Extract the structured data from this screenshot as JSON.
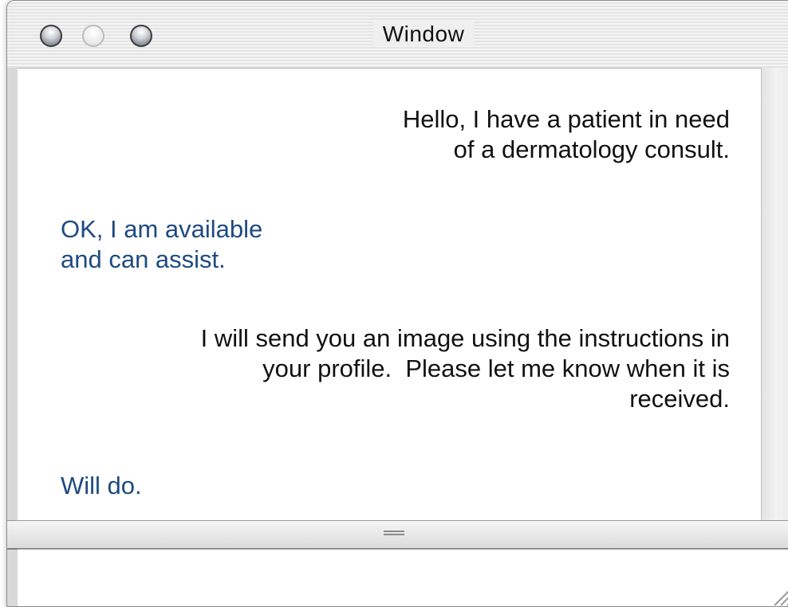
{
  "window": {
    "title": "Window"
  },
  "messages": [
    {
      "direction": "out",
      "lines": [
        "Hello, I have a patient in need",
        "of a dermatology consult."
      ]
    },
    {
      "direction": "in",
      "lines": [
        "OK, I am available",
        "and can assist."
      ]
    },
    {
      "direction": "out",
      "lines": [
        "I will send you an image using the instructions in",
        "your profile.  Please let me know when it is",
        "received."
      ]
    },
    {
      "direction": "in",
      "lines": [
        "Will do."
      ]
    }
  ],
  "input": {
    "value": ""
  },
  "colors": {
    "incoming_text": "#1e4a80",
    "outgoing_text": "#111111"
  },
  "icons": {
    "close": "close-icon",
    "minimize": "minimize-icon",
    "zoom": "zoom-icon",
    "splitter_grip": "grip-icon",
    "resize": "resize-grip-icon"
  }
}
